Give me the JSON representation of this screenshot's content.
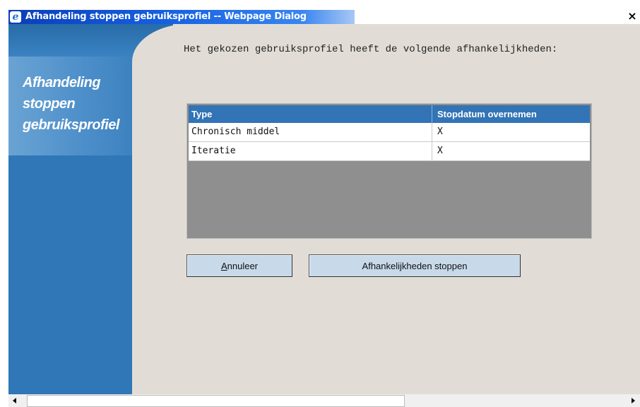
{
  "window": {
    "title": "Afhandeling stoppen gebruiksprofiel -- Webpage Dialog",
    "app_icon": "ie-icon",
    "close_icon": "close-icon",
    "close_glyph": "×"
  },
  "sidebar": {
    "title_lines": [
      "Afhandeling",
      "stoppen",
      "gebruiksprofiel"
    ]
  },
  "main": {
    "intro": "Het gekozen gebruiksprofiel heeft de volgende afhankelijkheden:",
    "table": {
      "columns": [
        "Type",
        "Stopdatum overnemen"
      ],
      "rows": [
        [
          "Chronisch middel",
          "X"
        ],
        [
          "Iteratie",
          "X"
        ]
      ]
    },
    "buttons": {
      "cancel_label": "Annuleer",
      "cancel_accesskey": "A",
      "cancel_rest": "nnuleer",
      "stop_label": "Afhankelijkheden stoppen"
    }
  },
  "colors": {
    "sidebar": "#2f77b7",
    "table_header": "#3274b6",
    "button": "#c8d9ea",
    "background": "#e1ddd6"
  }
}
